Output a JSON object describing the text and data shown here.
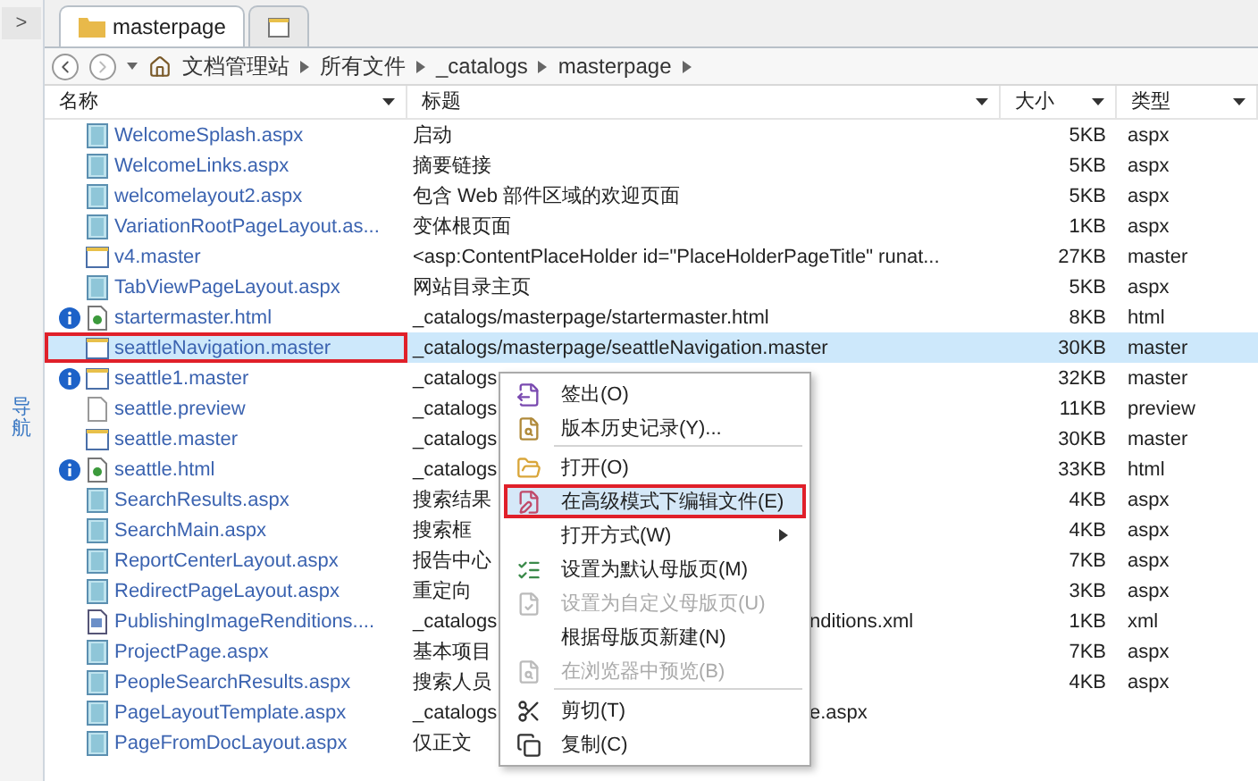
{
  "sidebar": {
    "expand_glyph": ">",
    "label": "导航"
  },
  "tabs": [
    {
      "label": "masterpage",
      "kind": "folder",
      "selected": true
    },
    {
      "kind": "new",
      "selected": false
    }
  ],
  "breadcrumb": [
    "文档管理站",
    "所有文件",
    "_catalogs",
    "masterpage"
  ],
  "columns": [
    {
      "label": "名称"
    },
    {
      "label": "标题"
    },
    {
      "label": "大小"
    },
    {
      "label": "类型"
    }
  ],
  "rows": [
    {
      "name": "WelcomeSplash.aspx",
      "kind": "layout",
      "info": false,
      "title": "启动",
      "size": "5KB",
      "type": "aspx",
      "selected": false,
      "outlined": false
    },
    {
      "name": "WelcomeLinks.aspx",
      "kind": "layout",
      "info": false,
      "title": "摘要链接",
      "size": "5KB",
      "type": "aspx",
      "selected": false,
      "outlined": false
    },
    {
      "name": "welcomelayout2.aspx",
      "kind": "layout",
      "info": false,
      "title": "包含 Web 部件区域的欢迎页面",
      "size": "5KB",
      "type": "aspx",
      "selected": false,
      "outlined": false
    },
    {
      "name": "VariationRootPageLayout.as...",
      "kind": "layout",
      "info": false,
      "title": "变体根页面",
      "size": "1KB",
      "type": "aspx",
      "selected": false,
      "outlined": false
    },
    {
      "name": "v4.master",
      "kind": "window",
      "info": false,
      "title": "<asp:ContentPlaceHolder id=\"PlaceHolderPageTitle\" runat...",
      "size": "27KB",
      "type": "master",
      "selected": false,
      "outlined": false
    },
    {
      "name": "TabViewPageLayout.aspx",
      "kind": "layout",
      "info": false,
      "title": "网站目录主页",
      "size": "5KB",
      "type": "aspx",
      "selected": false,
      "outlined": false
    },
    {
      "name": "startermaster.html",
      "kind": "doc",
      "info": true,
      "title": "_catalogs/masterpage/startermaster.html",
      "size": "8KB",
      "type": "html",
      "selected": false,
      "outlined": false
    },
    {
      "name": "seattleNavigation.master",
      "kind": "window",
      "info": false,
      "title": "_catalogs/masterpage/seattleNavigation.master",
      "size": "30KB",
      "type": "master",
      "selected": true,
      "outlined": true
    },
    {
      "name": "seattle1.master",
      "kind": "window",
      "info": true,
      "title": "_catalogs",
      "size": "32KB",
      "type": "master",
      "selected": false,
      "outlined": false
    },
    {
      "name": "seattle.preview",
      "kind": "blank",
      "info": false,
      "title": "_catalogs",
      "size": "11KB",
      "type": "preview",
      "selected": false,
      "outlined": false
    },
    {
      "name": "seattle.master",
      "kind": "window",
      "info": false,
      "title": "_catalogs",
      "size": "30KB",
      "type": "master",
      "selected": false,
      "outlined": false
    },
    {
      "name": "seattle.html",
      "kind": "doc",
      "info": true,
      "title": "_catalogs",
      "size": "33KB",
      "type": "html",
      "selected": false,
      "outlined": false
    },
    {
      "name": "SearchResults.aspx",
      "kind": "layout",
      "info": false,
      "title": "搜索结果",
      "size": "4KB",
      "type": "aspx",
      "selected": false,
      "outlined": false
    },
    {
      "name": "SearchMain.aspx",
      "kind": "layout",
      "info": false,
      "title": "搜索框",
      "size": "4KB",
      "type": "aspx",
      "selected": false,
      "outlined": false
    },
    {
      "name": "ReportCenterLayout.aspx",
      "kind": "layout",
      "info": false,
      "title": "报告中心",
      "size": "7KB",
      "type": "aspx",
      "selected": false,
      "outlined": false
    },
    {
      "name": "RedirectPageLayout.aspx",
      "kind": "layout",
      "info": false,
      "title": "重定向",
      "size": "3KB",
      "type": "aspx",
      "selected": false,
      "outlined": false
    },
    {
      "name": "PublishingImageRenditions....",
      "kind": "image",
      "info": false,
      "title": "_catalogs",
      "title_end": "nditions.xml",
      "size": "1KB",
      "type": "xml",
      "selected": false,
      "outlined": false
    },
    {
      "name": "ProjectPage.aspx",
      "kind": "layout",
      "info": false,
      "title": "基本项目",
      "size": "7KB",
      "type": "aspx",
      "selected": false,
      "outlined": false
    },
    {
      "name": "PeopleSearchResults.aspx",
      "kind": "layout",
      "info": false,
      "title": "搜索人员",
      "size": "4KB",
      "type": "aspx",
      "selected": false,
      "outlined": false
    },
    {
      "name": "PageLayoutTemplate.aspx",
      "kind": "layout",
      "info": false,
      "title": "_catalogs",
      "title_end": "e.aspx",
      "selected": false,
      "outlined": false
    },
    {
      "name": "PageFromDocLayout.aspx",
      "kind": "layout",
      "info": false,
      "title": "仅正文",
      "selected": false,
      "outlined": false
    }
  ],
  "context_menu": [
    {
      "label": "签出(O)",
      "kind": "checkout",
      "disabled": false,
      "highlighted": false,
      "submenu": false,
      "separator_after": false
    },
    {
      "label": "版本历史记录(Y)...",
      "kind": "history",
      "disabled": false,
      "highlighted": false,
      "submenu": false,
      "separator_after": true
    },
    {
      "label": "打开(O)",
      "kind": "open",
      "disabled": false,
      "highlighted": false,
      "submenu": false,
      "separator_after": false
    },
    {
      "label": "在高级模式下编辑文件(E)",
      "kind": "edit",
      "disabled": false,
      "highlighted": true,
      "submenu": false,
      "separator_after": false
    },
    {
      "label": "打开方式(W)",
      "kind": "plain",
      "disabled": false,
      "highlighted": false,
      "submenu": true,
      "separator_after": false
    },
    {
      "label": "设置为默认母版页(M)",
      "kind": "setdefault",
      "disabled": false,
      "highlighted": false,
      "submenu": false,
      "separator_after": false
    },
    {
      "label": "设置为自定义母版页(U)",
      "kind": "setcustom",
      "disabled": true,
      "highlighted": false,
      "submenu": false,
      "separator_after": false
    },
    {
      "label": "根据母版页新建(N)",
      "kind": "plain",
      "disabled": false,
      "highlighted": false,
      "submenu": false,
      "separator_after": false
    },
    {
      "label": "在浏览器中预览(B)",
      "kind": "preview",
      "disabled": true,
      "highlighted": false,
      "submenu": false,
      "separator_after": true
    },
    {
      "label": "剪切(T)",
      "kind": "cut",
      "disabled": false,
      "highlighted": false,
      "submenu": false,
      "separator_after": false
    },
    {
      "label": "复制(C)",
      "kind": "copy",
      "disabled": false,
      "highlighted": false,
      "submenu": false,
      "separator_after": false
    }
  ]
}
